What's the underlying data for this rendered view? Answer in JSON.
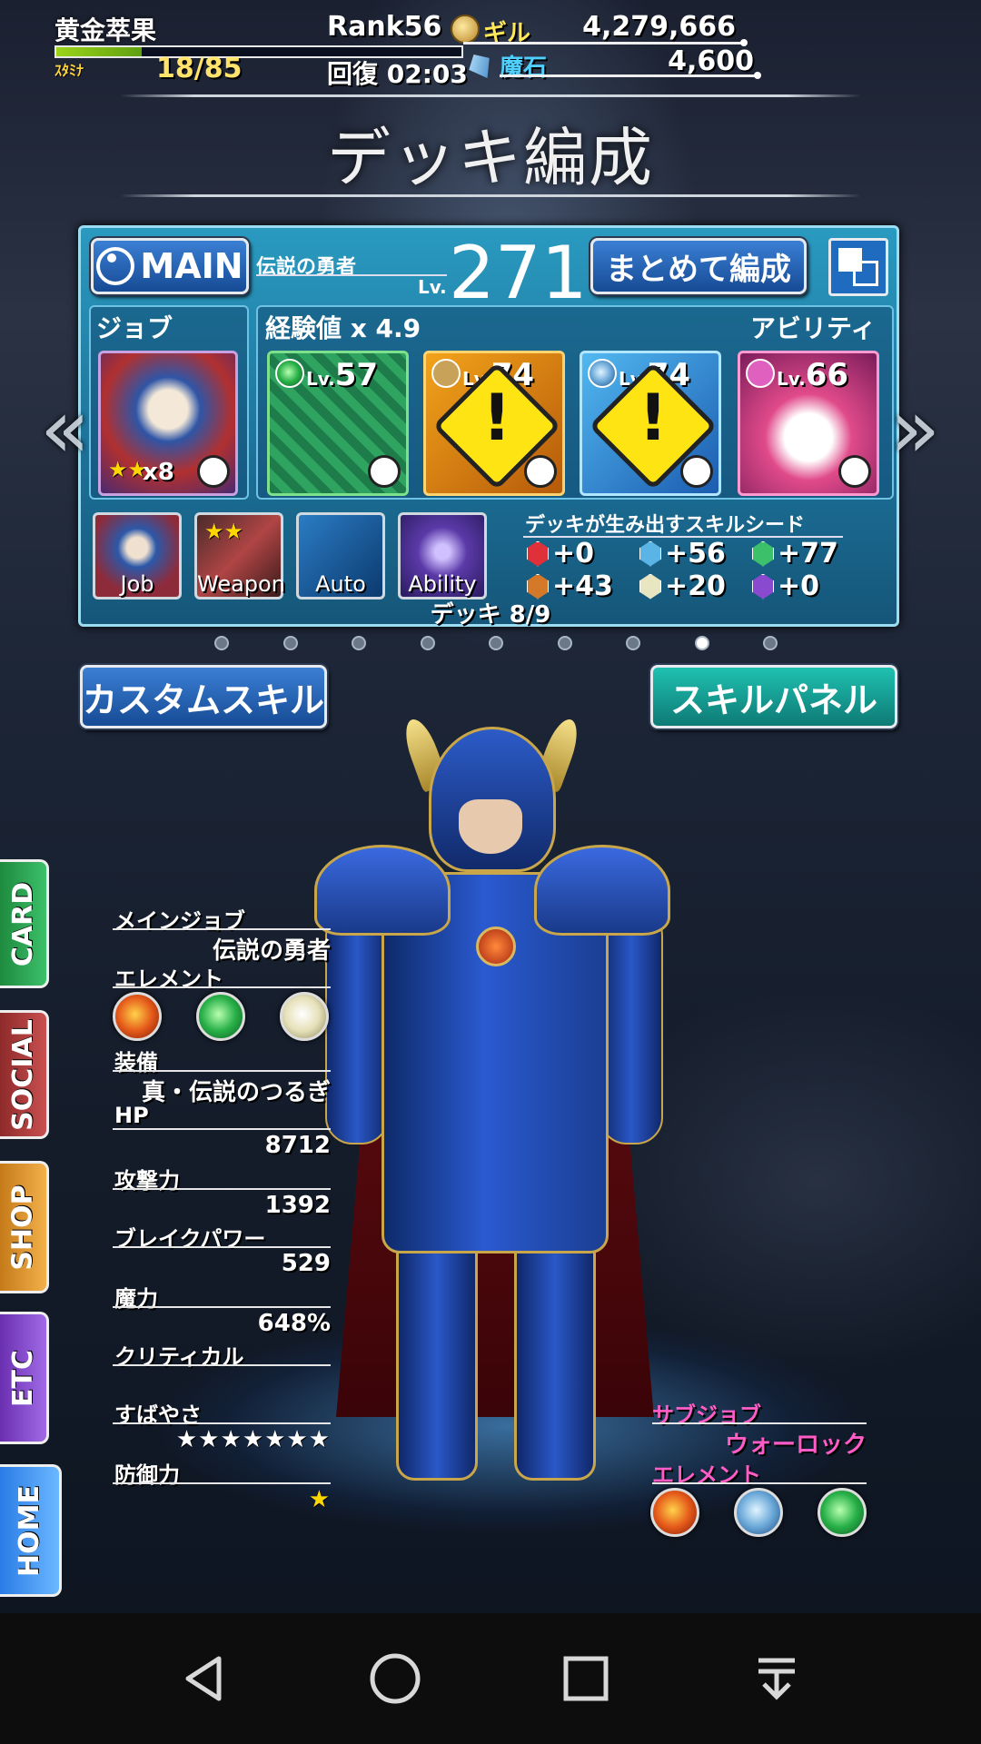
{
  "status": {
    "player_name": "黄金萃果",
    "stamina_label": "ｽﾀﾐﾅ",
    "stamina_value": "18/85",
    "stamina_fraction": 0.21,
    "rank": "Rank56",
    "recover": "回復 02:03",
    "gil_label": "ギル",
    "gil_value": "4,279,666",
    "stone_label": "魔石",
    "stone_value": "4,600"
  },
  "page_title": "デッキ編成",
  "deck": {
    "main_label": "MAIN",
    "job_name": "伝説の勇者",
    "lv_label": "Lv.",
    "level": "271",
    "matome_label": "まとめて編成",
    "job_section": "ジョブ",
    "exp_section": "経験値 x 4.9",
    "ability_section": "アビリティ",
    "job_card_count": "x8",
    "cards": [
      {
        "lv_prefix": "Lv.",
        "lv": "57"
      },
      {
        "lv_prefix": "Lv.",
        "lv": "74"
      },
      {
        "lv_prefix": "Lv.",
        "lv": "74"
      },
      {
        "lv_prefix": "Lv.",
        "lv": "66"
      }
    ],
    "slots": {
      "job": "Job",
      "weapon": "Weapon",
      "auto": "Auto",
      "ability": "Ability"
    },
    "seed_title": "デッキが生み出すスキルシード",
    "seeds": [
      "+0",
      "+56",
      "+77",
      "+43",
      "+20",
      "+0"
    ],
    "seed_colors": [
      "#e0303a",
      "#5ab4e6",
      "#3cc06a",
      "#d4782a",
      "#e8e6c0",
      "#8a4ad0"
    ],
    "deck_count": "デッキ 8/9",
    "total_pages": 9,
    "active_page": 8
  },
  "buttons": {
    "custom_skill": "カスタムスキル",
    "skill_panel": "スキルパネル"
  },
  "side_tabs": {
    "card": "CARD",
    "social": "SOCIAL",
    "shop": "SHOP",
    "etc": "ETC",
    "home": "HOME"
  },
  "stats": {
    "main_job_label": "メインジョブ",
    "main_job_value": "伝説の勇者",
    "element_label": "エレメント",
    "equip_label": "装備",
    "equip_value": "真・伝説のつるぎ",
    "hp_label": "HP",
    "hp_value": "8712",
    "atk_label": "攻撃力",
    "atk_value": "1392",
    "break_label": "ブレイクパワー",
    "break_value": "529",
    "magic_label": "魔力",
    "magic_value": "648%",
    "crit_label": "クリティカル",
    "speed_label": "すばやさ",
    "speed_stars": "★★★★★★★",
    "def_label": "防御力",
    "def_stars": "★"
  },
  "sub": {
    "sub_job_label": "サブジョブ",
    "sub_job_value": "ウォーロック",
    "element_label": "エレメント"
  }
}
